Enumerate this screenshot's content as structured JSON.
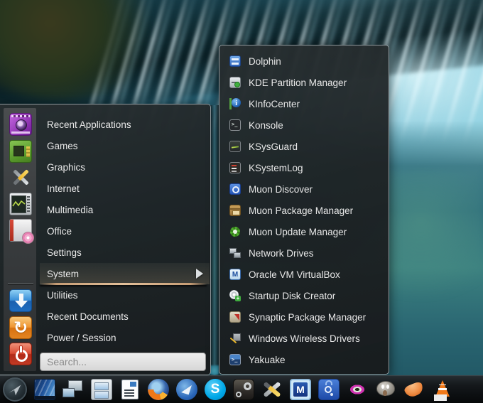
{
  "colors": {
    "selection_underline": "#e3c09a",
    "panel_background": "#1e2325",
    "panel_border": "#a5afb4",
    "text": "#e9e9e9",
    "search_placeholder_color": "#8a8a8a",
    "taskbar_background": "#0b0e10",
    "wallpaper_teal": "#3c87a0"
  },
  "menu": {
    "categories": [
      {
        "label": "Recent Applications"
      },
      {
        "label": "Games"
      },
      {
        "label": "Graphics"
      },
      {
        "label": "Internet"
      },
      {
        "label": "Multimedia"
      },
      {
        "label": "Office"
      },
      {
        "label": "Settings"
      },
      {
        "label": "System",
        "selected": true,
        "has_submenu": true
      },
      {
        "label": "Utilities"
      },
      {
        "label": "Recent Documents"
      },
      {
        "label": "Power / Session"
      }
    ],
    "side_icons_top": [
      "recent-applications-icon",
      "games-icon",
      "crossed-tools-icon",
      "oscilloscope-icon",
      "printer-icon"
    ],
    "side_icons_bottom": [
      "download-icon",
      "restart-icon",
      "shutdown-icon"
    ],
    "search": {
      "placeholder": "Search..."
    }
  },
  "submenu": {
    "items": [
      {
        "label": "Dolphin",
        "icon": "dolphin-icon"
      },
      {
        "label": "KDE Partition Manager",
        "icon": "kde-partition-manager-icon"
      },
      {
        "label": "KInfoCenter",
        "icon": "kinfocenter-icon"
      },
      {
        "label": "Konsole",
        "icon": "konsole-icon"
      },
      {
        "label": "KSysGuard",
        "icon": "ksysguard-icon"
      },
      {
        "label": "KSystemLog",
        "icon": "ksystemlog-icon"
      },
      {
        "label": "Muon Discover",
        "icon": "muon-discover-icon"
      },
      {
        "label": "Muon Package Manager",
        "icon": "muon-package-manager-icon"
      },
      {
        "label": "Muon Update Manager",
        "icon": "muon-update-manager-icon"
      },
      {
        "label": "Network Drives",
        "icon": "network-drives-icon"
      },
      {
        "label": "Oracle VM VirtualBox",
        "icon": "virtualbox-icon"
      },
      {
        "label": "Startup Disk Creator",
        "icon": "startup-disk-creator-icon"
      },
      {
        "label": "Synaptic Package Manager",
        "icon": "synaptic-icon"
      },
      {
        "label": "Windows Wireless Drivers",
        "icon": "windows-wireless-drivers-icon"
      },
      {
        "label": "Yakuake",
        "icon": "yakuake-icon"
      }
    ]
  },
  "taskbar": {
    "items": [
      {
        "icon": "app-launcher-icon"
      },
      {
        "icon": "desktop-icon"
      },
      {
        "icon": "displays-icon"
      },
      {
        "icon": "file-cabinet-icon"
      },
      {
        "icon": "document-icon"
      },
      {
        "icon": "firefox-icon"
      },
      {
        "icon": "thunderbird-icon"
      },
      {
        "icon": "skype-icon"
      },
      {
        "icon": "steam-icon"
      },
      {
        "icon": "tools-icon"
      },
      {
        "icon": "virtualbox-icon"
      },
      {
        "icon": "muon-discover-icon"
      },
      {
        "icon": "eye-icon"
      },
      {
        "icon": "gimp-icon"
      },
      {
        "icon": "clementine-icon"
      },
      {
        "icon": "vlc-icon"
      }
    ]
  }
}
